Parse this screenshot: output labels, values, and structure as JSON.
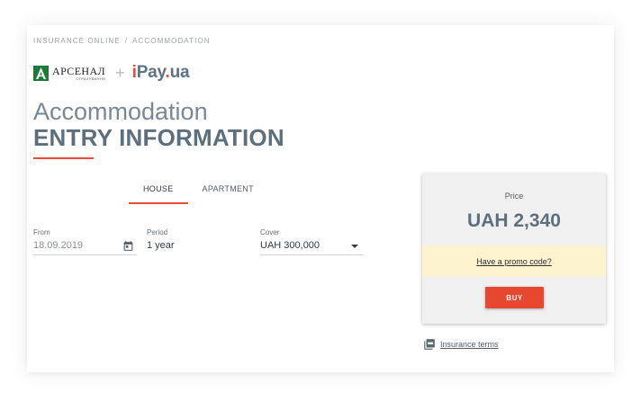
{
  "breadcrumb": {
    "items": [
      "INSURANCE ONLINE",
      "ACCOMMODATION"
    ],
    "separator": "/"
  },
  "logos": {
    "arsenal_name": "АРСЕНАЛ",
    "arsenal_sub": "СТРАХУВАННЯ",
    "plus": "+",
    "ipay_i": "i",
    "ipay_pay": "Pay",
    "ipay_dot": ".",
    "ipay_ua": "ua"
  },
  "header": {
    "title": "Accommodation",
    "subtitle": "ENTRY INFORMATION"
  },
  "tabs": [
    {
      "label": "HOUSE",
      "active": true
    },
    {
      "label": "APARTMENT",
      "active": false
    }
  ],
  "form": {
    "from": {
      "label": "From",
      "value": "18.09.2019",
      "icon": "calendar-icon"
    },
    "period": {
      "label": "Period",
      "value": "1 year"
    },
    "cover": {
      "label": "Cover",
      "value": "UAH 300,000",
      "icon": "chevron-down-icon"
    }
  },
  "price_panel": {
    "label": "Price",
    "value": "UAH 2,340",
    "promo_link": "Have a promo code?",
    "buy_label": "BUY"
  },
  "terms": {
    "icon": "pdf-icon",
    "link": "Insurance terms"
  },
  "colors": {
    "accent": "#e74c3c",
    "slate": "#5d6f7c",
    "promo_bg": "#fdf3ce",
    "arsenal_green": "#1f7a3a"
  }
}
